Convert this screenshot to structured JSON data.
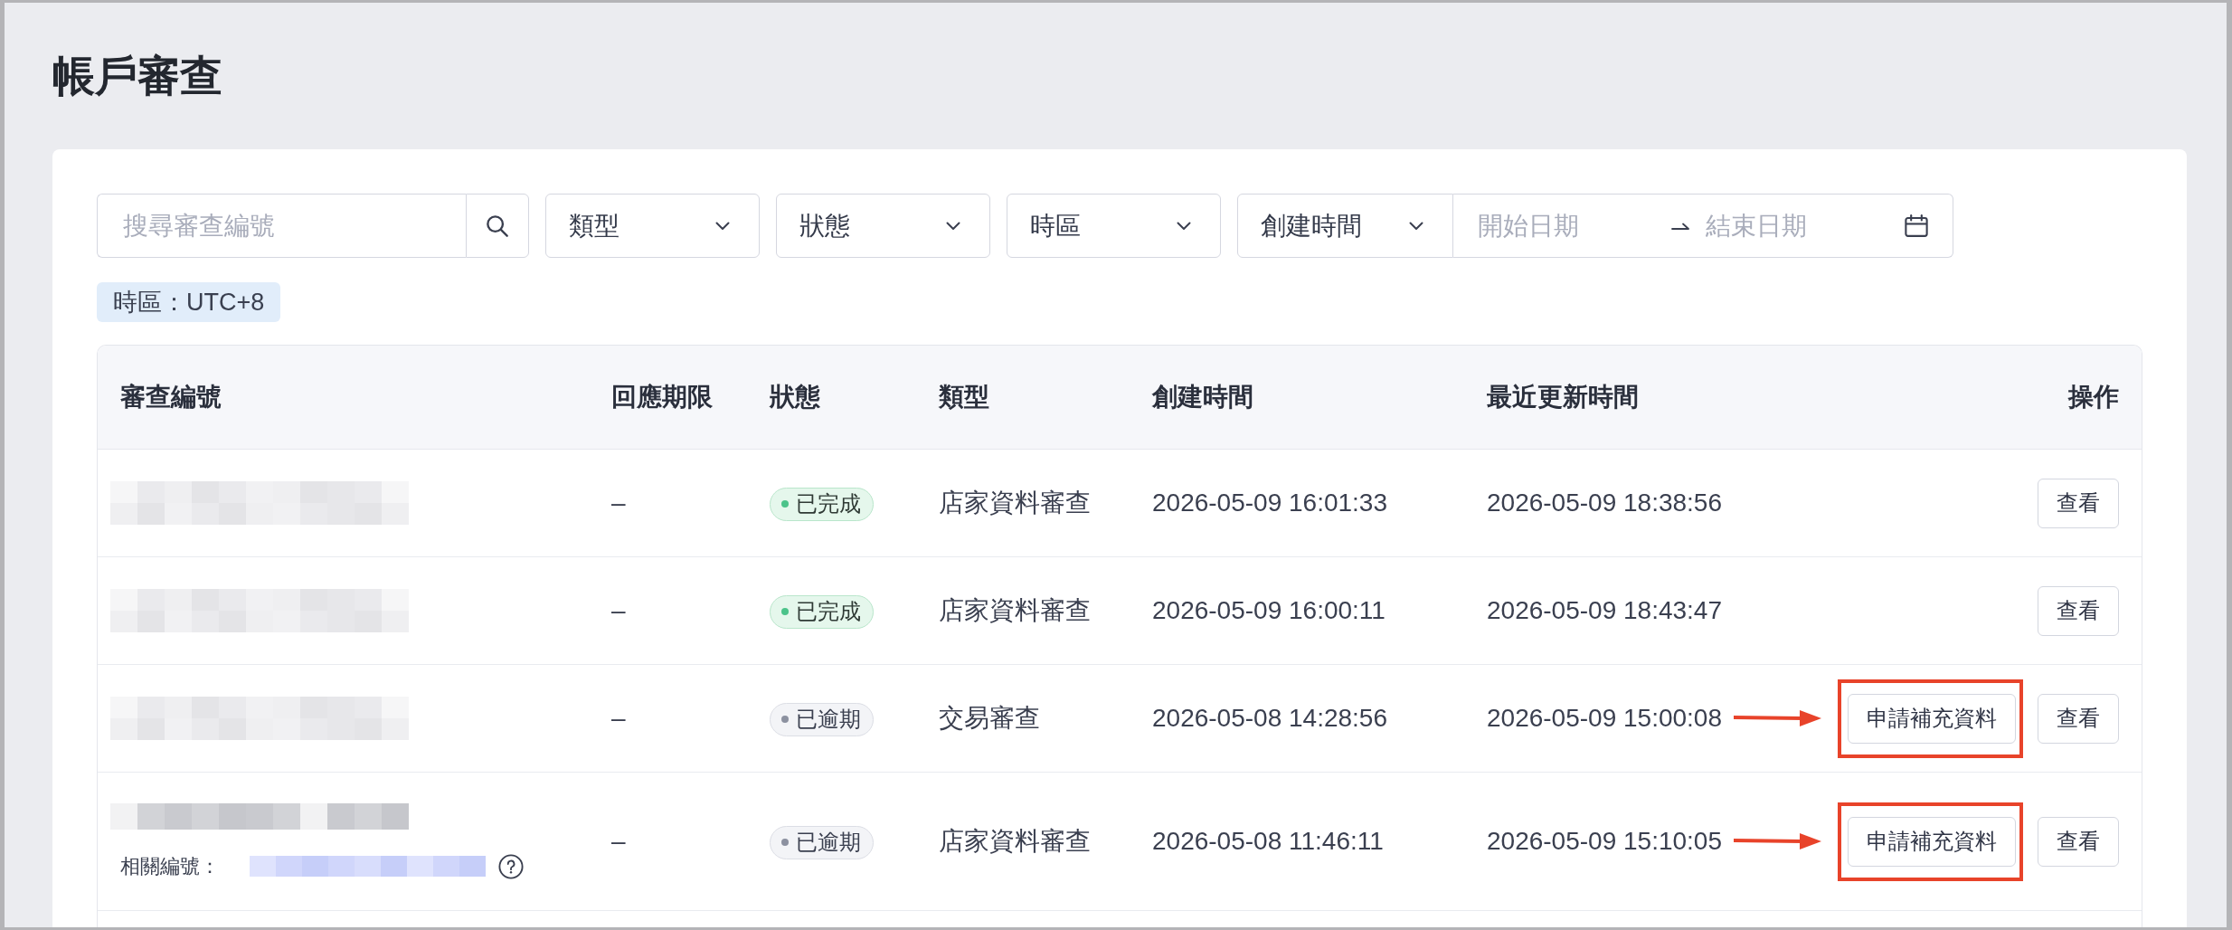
{
  "page": {
    "title": "帳戶審查"
  },
  "filters": {
    "search": {
      "placeholder": "搜尋審查編號"
    },
    "dropdowns": [
      {
        "label": "類型"
      },
      {
        "label": "狀態"
      },
      {
        "label": "時區"
      }
    ],
    "date_filter": {
      "field": "創建時間",
      "start_placeholder": "開始日期",
      "end_placeholder": "結束日期"
    }
  },
  "timezone_tag": "時區：UTC+8",
  "table": {
    "columns": [
      "審查編號",
      "回應期限",
      "狀態",
      "類型",
      "創建時間",
      "最近更新時間",
      "操作"
    ],
    "rows": [
      {
        "review_id_pixelated": true,
        "deadline": "–",
        "status": {
          "label": "已完成",
          "kind": "success",
          "color": "#4cc38a"
        },
        "type": "店家資料審查",
        "created": "2026-05-09 16:01:33",
        "updated": "2026-05-09 18:38:56",
        "actions": [
          {
            "label": "查看",
            "highlighted": false
          }
        ]
      },
      {
        "review_id_pixelated": true,
        "deadline": "–",
        "status": {
          "label": "已完成",
          "kind": "success",
          "color": "#4cc38a"
        },
        "type": "店家資料審查",
        "created": "2026-05-09 16:00:11",
        "updated": "2026-05-09 18:43:47",
        "actions": [
          {
            "label": "查看",
            "highlighted": false
          }
        ]
      },
      {
        "review_id_pixelated": true,
        "deadline": "–",
        "status": {
          "label": "已逾期",
          "kind": "neutral",
          "color": "#8c91a0"
        },
        "type": "交易審查",
        "created": "2026-05-08 14:28:56",
        "updated": "2026-05-09 15:00:08",
        "actions": [
          {
            "label": "申請補充資料",
            "highlighted": true
          },
          {
            "label": "查看",
            "highlighted": false
          }
        ]
      },
      {
        "review_id_pixelated": true,
        "related_id": {
          "label": "相關編號：",
          "pixelated": true,
          "help": true
        },
        "deadline": "–",
        "status": {
          "label": "已逾期",
          "kind": "neutral",
          "color": "#8c91a0"
        },
        "type": "店家資料審查",
        "created": "2026-05-08 11:46:11",
        "updated": "2026-05-09 15:10:05",
        "actions": [
          {
            "label": "申請補充資料",
            "highlighted": true
          },
          {
            "label": "查看",
            "highlighted": false
          }
        ]
      }
    ]
  }
}
